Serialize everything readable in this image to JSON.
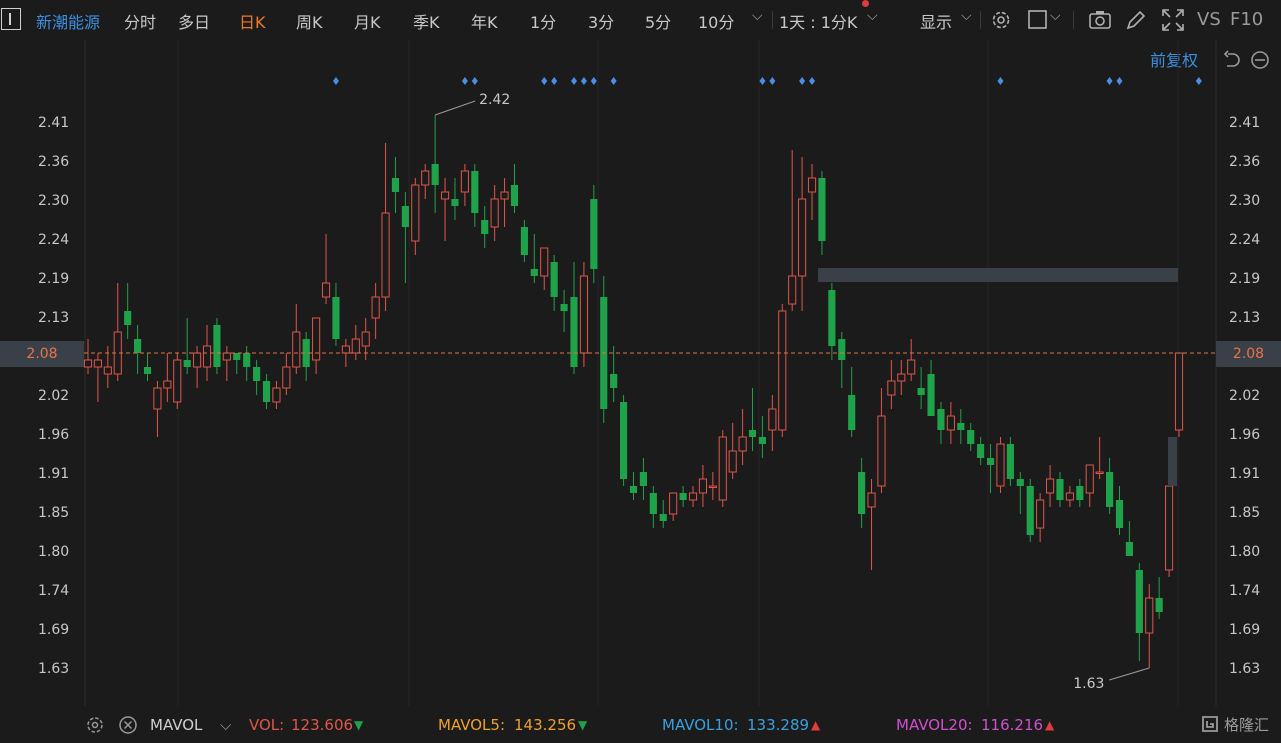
{
  "toolbar": {
    "stock_name": "新潮能源",
    "periods": [
      "分时",
      "多日",
      "日K",
      "周K",
      "月K",
      "季K",
      "年K",
      "1分",
      "3分",
      "5分",
      "10分"
    ],
    "active_period": "日K",
    "combo_period": "1天 : 1分K",
    "display_label": "显示",
    "vs_label": "VS",
    "f10_label": "F10"
  },
  "subbar": {
    "adjust_label": "前复权"
  },
  "price_axis": {
    "ticks": [
      "2.41",
      "2.36",
      "2.30",
      "2.24",
      "2.19",
      "2.13",
      "2.08",
      "2.02",
      "1.96",
      "1.91",
      "1.85",
      "1.80",
      "1.74",
      "1.69",
      "1.63"
    ],
    "current_price": "2.08"
  },
  "annotations": {
    "high_label": "2.42",
    "low_label": "1.63"
  },
  "volume_indicator": {
    "name": "MAVOL",
    "vol_label": "VOL:",
    "vol_value": "123.606",
    "mavol5_label": "MAVOL5:",
    "mavol5_value": "143.256",
    "mavol10_label": "MAVOL10:",
    "mavol10_value": "133.289",
    "mavol20_label": "MAVOL20:",
    "mavol20_value": "116.216"
  },
  "brand": "格隆汇",
  "colors": {
    "up": "#e0564a",
    "down": "#1fa34a",
    "accent": "#f07828",
    "link": "#3d8fe0",
    "mavol5": "#f0a030",
    "mavol10": "#3aa0e0",
    "mavol20": "#d050d0"
  },
  "chart_data": {
    "type": "candlestick",
    "ylim": [
      1.6,
      2.45
    ],
    "current_price": 2.08,
    "high": 2.42,
    "low": 1.63,
    "candles": [
      {
        "o": 2.06,
        "h": 2.1,
        "l": 2.05,
        "c": 2.07
      },
      {
        "o": 2.06,
        "h": 2.08,
        "l": 2.01,
        "c": 2.07
      },
      {
        "o": 2.05,
        "h": 2.09,
        "l": 2.03,
        "c": 2.06
      },
      {
        "o": 2.05,
        "h": 2.18,
        "l": 2.04,
        "c": 2.11
      },
      {
        "o": 2.14,
        "h": 2.18,
        "l": 2.1,
        "c": 2.12
      },
      {
        "o": 2.1,
        "h": 2.12,
        "l": 2.05,
        "c": 2.08
      },
      {
        "o": 2.06,
        "h": 2.08,
        "l": 2.04,
        "c": 2.05
      },
      {
        "o": 2.0,
        "h": 2.04,
        "l": 1.96,
        "c": 2.03
      },
      {
        "o": 2.03,
        "h": 2.08,
        "l": 2.01,
        "c": 2.04
      },
      {
        "o": 2.01,
        "h": 2.08,
        "l": 2.0,
        "c": 2.07
      },
      {
        "o": 2.07,
        "h": 2.13,
        "l": 2.05,
        "c": 2.06
      },
      {
        "o": 2.06,
        "h": 2.09,
        "l": 2.03,
        "c": 2.08
      },
      {
        "o": 2.06,
        "h": 2.12,
        "l": 2.04,
        "c": 2.09
      },
      {
        "o": 2.12,
        "h": 2.13,
        "l": 2.05,
        "c": 2.06
      },
      {
        "o": 2.07,
        "h": 2.09,
        "l": 2.04,
        "c": 2.08
      },
      {
        "o": 2.08,
        "h": 2.08,
        "l": 2.05,
        "c": 2.07
      },
      {
        "o": 2.08,
        "h": 2.09,
        "l": 2.04,
        "c": 2.06
      },
      {
        "o": 2.06,
        "h": 2.07,
        "l": 2.02,
        "c": 2.04
      },
      {
        "o": 2.04,
        "h": 2.05,
        "l": 2.0,
        "c": 2.01
      },
      {
        "o": 2.01,
        "h": 2.04,
        "l": 2.0,
        "c": 2.03
      },
      {
        "o": 2.03,
        "h": 2.08,
        "l": 2.02,
        "c": 2.06
      },
      {
        "o": 2.06,
        "h": 2.15,
        "l": 2.05,
        "c": 2.11
      },
      {
        "o": 2.1,
        "h": 2.11,
        "l": 2.04,
        "c": 2.06
      },
      {
        "o": 2.07,
        "h": 2.13,
        "l": 2.05,
        "c": 2.13
      },
      {
        "o": 2.16,
        "h": 2.25,
        "l": 2.15,
        "c": 2.18
      },
      {
        "o": 2.16,
        "h": 2.18,
        "l": 2.09,
        "c": 2.1
      },
      {
        "o": 2.08,
        "h": 2.1,
        "l": 2.06,
        "c": 2.09
      },
      {
        "o": 2.08,
        "h": 2.12,
        "l": 2.07,
        "c": 2.1
      },
      {
        "o": 2.09,
        "h": 2.13,
        "l": 2.07,
        "c": 2.11
      },
      {
        "o": 2.13,
        "h": 2.18,
        "l": 2.1,
        "c": 2.16
      },
      {
        "o": 2.16,
        "h": 2.38,
        "l": 2.14,
        "c": 2.28
      },
      {
        "o": 2.33,
        "h": 2.36,
        "l": 2.28,
        "c": 2.31
      },
      {
        "o": 2.29,
        "h": 2.31,
        "l": 2.18,
        "c": 2.26
      },
      {
        "o": 2.24,
        "h": 2.33,
        "l": 2.22,
        "c": 2.32
      },
      {
        "o": 2.32,
        "h": 2.35,
        "l": 2.3,
        "c": 2.34
      },
      {
        "o": 2.35,
        "h": 2.42,
        "l": 2.28,
        "c": 2.32
      },
      {
        "o": 2.3,
        "h": 2.33,
        "l": 2.24,
        "c": 2.31
      },
      {
        "o": 2.3,
        "h": 2.33,
        "l": 2.27,
        "c": 2.29
      },
      {
        "o": 2.31,
        "h": 2.35,
        "l": 2.29,
        "c": 2.34
      },
      {
        "o": 2.34,
        "h": 2.35,
        "l": 2.26,
        "c": 2.28
      },
      {
        "o": 2.27,
        "h": 2.29,
        "l": 2.23,
        "c": 2.25
      },
      {
        "o": 2.26,
        "h": 2.32,
        "l": 2.24,
        "c": 2.3
      },
      {
        "o": 2.3,
        "h": 2.33,
        "l": 2.26,
        "c": 2.31
      },
      {
        "o": 2.32,
        "h": 2.35,
        "l": 2.28,
        "c": 2.29
      },
      {
        "o": 2.26,
        "h": 2.27,
        "l": 2.21,
        "c": 2.22
      },
      {
        "o": 2.2,
        "h": 2.25,
        "l": 2.18,
        "c": 2.19
      },
      {
        "o": 2.19,
        "h": 2.23,
        "l": 2.17,
        "c": 2.23
      },
      {
        "o": 2.21,
        "h": 2.22,
        "l": 2.14,
        "c": 2.16
      },
      {
        "o": 2.15,
        "h": 2.17,
        "l": 2.11,
        "c": 2.14
      },
      {
        "o": 2.16,
        "h": 2.21,
        "l": 2.05,
        "c": 2.06
      },
      {
        "o": 2.08,
        "h": 2.21,
        "l": 2.06,
        "c": 2.19
      },
      {
        "o": 2.3,
        "h": 2.32,
        "l": 2.18,
        "c": 2.2
      },
      {
        "o": 2.16,
        "h": 2.19,
        "l": 1.98,
        "c": 2.0
      },
      {
        "o": 2.05,
        "h": 2.09,
        "l": 2.01,
        "c": 2.03
      },
      {
        "o": 2.01,
        "h": 2.02,
        "l": 1.89,
        "c": 1.9
      },
      {
        "o": 1.89,
        "h": 1.91,
        "l": 1.87,
        "c": 1.88
      },
      {
        "o": 1.91,
        "h": 1.93,
        "l": 1.87,
        "c": 1.89
      },
      {
        "o": 1.88,
        "h": 1.89,
        "l": 1.83,
        "c": 1.85
      },
      {
        "o": 1.85,
        "h": 1.87,
        "l": 1.83,
        "c": 1.84
      },
      {
        "o": 1.85,
        "h": 1.88,
        "l": 1.84,
        "c": 1.88
      },
      {
        "o": 1.88,
        "h": 1.89,
        "l": 1.86,
        "c": 1.87
      },
      {
        "o": 1.87,
        "h": 1.89,
        "l": 1.86,
        "c": 1.88
      },
      {
        "o": 1.88,
        "h": 1.92,
        "l": 1.86,
        "c": 1.9
      },
      {
        "o": 1.89,
        "h": 1.91,
        "l": 1.87,
        "c": 1.89
      },
      {
        "o": 1.87,
        "h": 1.97,
        "l": 1.86,
        "c": 1.96
      },
      {
        "o": 1.91,
        "h": 1.98,
        "l": 1.9,
        "c": 1.94
      },
      {
        "o": 1.94,
        "h": 2.0,
        "l": 1.92,
        "c": 1.96
      },
      {
        "o": 1.97,
        "h": 2.03,
        "l": 1.94,
        "c": 1.96
      },
      {
        "o": 1.96,
        "h": 1.99,
        "l": 1.93,
        "c": 1.95
      },
      {
        "o": 1.97,
        "h": 2.02,
        "l": 1.94,
        "c": 2.0
      },
      {
        "o": 1.97,
        "h": 2.15,
        "l": 1.96,
        "c": 2.14
      },
      {
        "o": 2.15,
        "h": 2.37,
        "l": 2.14,
        "c": 2.19
      },
      {
        "o": 2.19,
        "h": 2.36,
        "l": 2.14,
        "c": 2.3
      },
      {
        "o": 2.31,
        "h": 2.35,
        "l": 2.27,
        "c": 2.33
      },
      {
        "o": 2.33,
        "h": 2.34,
        "l": 2.22,
        "c": 2.24
      },
      {
        "o": 2.17,
        "h": 2.18,
        "l": 2.07,
        "c": 2.09
      },
      {
        "o": 2.1,
        "h": 2.11,
        "l": 2.03,
        "c": 2.07
      },
      {
        "o": 2.02,
        "h": 2.06,
        "l": 1.96,
        "c": 1.97
      },
      {
        "o": 1.91,
        "h": 1.93,
        "l": 1.83,
        "c": 1.85
      },
      {
        "o": 1.86,
        "h": 1.9,
        "l": 1.77,
        "c": 1.88
      },
      {
        "o": 1.89,
        "h": 2.03,
        "l": 1.88,
        "c": 1.99
      },
      {
        "o": 2.02,
        "h": 2.07,
        "l": 2.0,
        "c": 2.04
      },
      {
        "o": 2.04,
        "h": 2.07,
        "l": 2.02,
        "c": 2.05
      },
      {
        "o": 2.05,
        "h": 2.1,
        "l": 2.04,
        "c": 2.07
      },
      {
        "o": 2.03,
        "h": 2.06,
        "l": 2.0,
        "c": 2.02
      },
      {
        "o": 2.05,
        "h": 2.07,
        "l": 1.99,
        "c": 1.99
      },
      {
        "o": 2.0,
        "h": 2.01,
        "l": 1.95,
        "c": 1.97
      },
      {
        "o": 1.97,
        "h": 2.01,
        "l": 1.95,
        "c": 1.99
      },
      {
        "o": 1.98,
        "h": 2.0,
        "l": 1.95,
        "c": 1.97
      },
      {
        "o": 1.97,
        "h": 1.98,
        "l": 1.94,
        "c": 1.95
      },
      {
        "o": 1.95,
        "h": 1.96,
        "l": 1.92,
        "c": 1.93
      },
      {
        "o": 1.93,
        "h": 1.95,
        "l": 1.88,
        "c": 1.92
      },
      {
        "o": 1.89,
        "h": 1.96,
        "l": 1.88,
        "c": 1.95
      },
      {
        "o": 1.95,
        "h": 1.96,
        "l": 1.89,
        "c": 1.9
      },
      {
        "o": 1.9,
        "h": 1.91,
        "l": 1.85,
        "c": 1.89
      },
      {
        "o": 1.89,
        "h": 1.9,
        "l": 1.81,
        "c": 1.82
      },
      {
        "o": 1.83,
        "h": 1.88,
        "l": 1.81,
        "c": 1.87
      },
      {
        "o": 1.88,
        "h": 1.92,
        "l": 1.86,
        "c": 1.9
      },
      {
        "o": 1.9,
        "h": 1.91,
        "l": 1.86,
        "c": 1.87
      },
      {
        "o": 1.87,
        "h": 1.89,
        "l": 1.86,
        "c": 1.88
      },
      {
        "o": 1.89,
        "h": 1.9,
        "l": 1.86,
        "c": 1.87
      },
      {
        "o": 1.88,
        "h": 1.92,
        "l": 1.86,
        "c": 1.92
      },
      {
        "o": 1.91,
        "h": 1.96,
        "l": 1.9,
        "c": 1.91
      },
      {
        "o": 1.91,
        "h": 1.93,
        "l": 1.85,
        "c": 1.86
      },
      {
        "o": 1.87,
        "h": 1.89,
        "l": 1.82,
        "c": 1.83
      },
      {
        "o": 1.81,
        "h": 1.84,
        "l": 1.79,
        "c": 1.79
      },
      {
        "o": 1.77,
        "h": 1.78,
        "l": 1.64,
        "c": 1.68
      },
      {
        "o": 1.68,
        "h": 1.75,
        "l": 1.63,
        "c": 1.73
      },
      {
        "o": 1.73,
        "h": 1.76,
        "l": 1.7,
        "c": 1.71
      },
      {
        "o": 1.77,
        "h": 1.91,
        "l": 1.76,
        "c": 1.89
      },
      {
        "o": 1.97,
        "h": 2.08,
        "l": 1.96,
        "c": 2.08
      }
    ],
    "resistance_level": 2.19,
    "marker_candle_indices": [
      25,
      38,
      39,
      46,
      47,
      49,
      50,
      51,
      53,
      68,
      69,
      72,
      73,
      92,
      103,
      104,
      112
    ]
  }
}
